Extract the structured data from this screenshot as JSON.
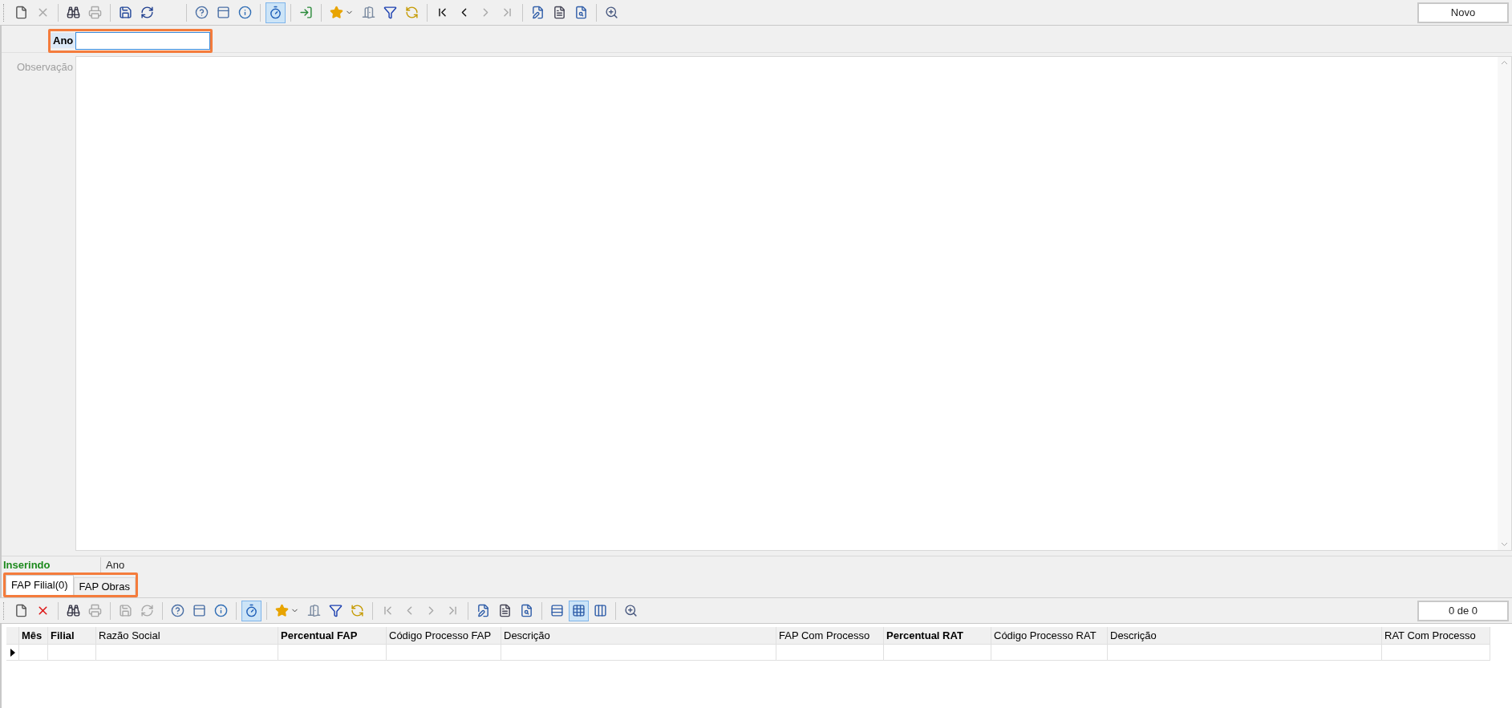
{
  "toolbar": {
    "buttons": [
      {
        "kind": "new",
        "disabled": false,
        "pressed": false
      },
      {
        "kind": "delete",
        "disabled": true,
        "pressed": false
      },
      {
        "kind": "separator"
      },
      {
        "kind": "find",
        "disabled": false,
        "pressed": false
      },
      {
        "kind": "print",
        "disabled": true,
        "pressed": false
      },
      {
        "kind": "separator"
      },
      {
        "kind": "save",
        "disabled": false,
        "pressed": false
      },
      {
        "kind": "refresh",
        "disabled": false,
        "pressed": false
      },
      {
        "kind": "gap"
      },
      {
        "kind": "separator"
      },
      {
        "kind": "help",
        "disabled": false,
        "pressed": false
      },
      {
        "kind": "form",
        "disabled": false,
        "pressed": false
      },
      {
        "kind": "info",
        "disabled": false,
        "pressed": false
      },
      {
        "kind": "separator"
      },
      {
        "kind": "timer",
        "disabled": false,
        "pressed": true
      },
      {
        "kind": "separator"
      },
      {
        "kind": "exit",
        "disabled": false,
        "pressed": false
      },
      {
        "kind": "separator"
      },
      {
        "kind": "favorite",
        "disabled": false,
        "pressed": false
      },
      {
        "kind": "door",
        "disabled": false,
        "pressed": false
      },
      {
        "kind": "filter",
        "disabled": false,
        "pressed": false
      },
      {
        "kind": "sync",
        "disabled": false,
        "pressed": false
      },
      {
        "kind": "separator"
      },
      {
        "kind": "first",
        "disabled": false,
        "pressed": false
      },
      {
        "kind": "prev",
        "disabled": false,
        "pressed": false
      },
      {
        "kind": "next",
        "disabled": true,
        "pressed": false
      },
      {
        "kind": "last",
        "disabled": true,
        "pressed": false
      },
      {
        "kind": "separator"
      },
      {
        "kind": "edit",
        "disabled": false,
        "pressed": false
      },
      {
        "kind": "report",
        "disabled": false,
        "pressed": false
      },
      {
        "kind": "report-search",
        "disabled": false,
        "pressed": false
      },
      {
        "kind": "separator"
      },
      {
        "kind": "preview",
        "disabled": false,
        "pressed": false
      }
    ],
    "status": "Novo"
  },
  "form": {
    "fields": [
      {
        "label": "Ano",
        "focused": true,
        "kind": "text"
      },
      {
        "label": "Observação",
        "focused": false,
        "kind": "memo"
      }
    ]
  },
  "status_bar": {
    "mode": "Inserindo",
    "field": "Ano"
  },
  "tabs": [
    {
      "label": "FAP Filial(0)",
      "selected": true
    },
    {
      "label": "FAP Obras",
      "selected": false
    }
  ],
  "grid_toolbar": {
    "buttons": [
      {
        "kind": "new",
        "disabled": false,
        "pressed": false
      },
      {
        "kind": "delete",
        "disabled": false,
        "pressed": false
      },
      {
        "kind": "separator"
      },
      {
        "kind": "find",
        "disabled": false,
        "pressed": false
      },
      {
        "kind": "print",
        "disabled": true,
        "pressed": false
      },
      {
        "kind": "separator"
      },
      {
        "kind": "save",
        "disabled": true,
        "pressed": false
      },
      {
        "kind": "refresh",
        "disabled": true,
        "pressed": false
      },
      {
        "kind": "separator"
      },
      {
        "kind": "help",
        "disabled": false,
        "pressed": false
      },
      {
        "kind": "form",
        "disabled": false,
        "pressed": false
      },
      {
        "kind": "info",
        "disabled": false,
        "pressed": false
      },
      {
        "kind": "separator"
      },
      {
        "kind": "timer",
        "disabled": false,
        "pressed": true
      },
      {
        "kind": "separator"
      },
      {
        "kind": "favorite",
        "disabled": false,
        "pressed": false
      },
      {
        "kind": "door",
        "disabled": false,
        "pressed": false
      },
      {
        "kind": "filter",
        "disabled": false,
        "pressed": false
      },
      {
        "kind": "sync",
        "disabled": false,
        "pressed": false
      },
      {
        "kind": "separator"
      },
      {
        "kind": "first",
        "disabled": true,
        "pressed": false
      },
      {
        "kind": "prev",
        "disabled": true,
        "pressed": false
      },
      {
        "kind": "next",
        "disabled": true,
        "pressed": false
      },
      {
        "kind": "last",
        "disabled": true,
        "pressed": false
      },
      {
        "kind": "separator"
      },
      {
        "kind": "edit",
        "disabled": false,
        "pressed": false
      },
      {
        "kind": "report",
        "disabled": false,
        "pressed": false
      },
      {
        "kind": "report-search",
        "disabled": false,
        "pressed": false
      },
      {
        "kind": "separator"
      },
      {
        "kind": "rows",
        "disabled": false,
        "pressed": false
      },
      {
        "kind": "grid",
        "disabled": false,
        "pressed": true
      },
      {
        "kind": "columns",
        "disabled": false,
        "pressed": false
      },
      {
        "kind": "separator"
      },
      {
        "kind": "preview",
        "disabled": false,
        "pressed": false
      }
    ],
    "status": "0 de 0"
  },
  "table": {
    "columns": [
      {
        "label": "Mês",
        "bold": true
      },
      {
        "label": "Filial",
        "bold": true
      },
      {
        "label": "Razão Social",
        "bold": false
      },
      {
        "label": "Percentual FAP",
        "bold": true
      },
      {
        "label": "Código Processo FAP",
        "bold": false
      },
      {
        "label": "Descrição",
        "bold": false
      },
      {
        "label": "FAP Com Processo",
        "bold": false
      },
      {
        "label": "Percentual RAT",
        "bold": true
      },
      {
        "label": "Código Processo RAT",
        "bold": false
      },
      {
        "label": "Descrição",
        "bold": false
      },
      {
        "label": "RAT Com Processo",
        "bold": false
      }
    ],
    "rows": [
      {
        "current": true
      }
    ]
  }
}
